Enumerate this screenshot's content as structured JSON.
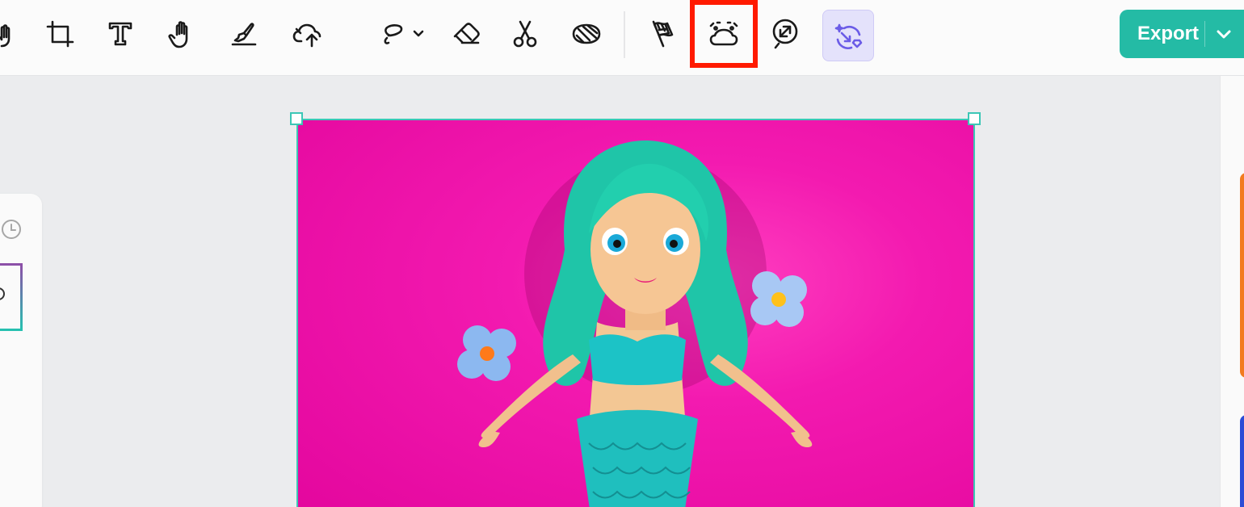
{
  "toolbar": {
    "tools": [
      {
        "name": "effects-tool",
        "icon": "partial-hand-icon"
      },
      {
        "name": "crop-tool",
        "icon": "crop-icon"
      },
      {
        "name": "text-tool",
        "icon": "text-icon"
      },
      {
        "name": "hand-tool",
        "icon": "hand-icon"
      },
      {
        "name": "brush-tool",
        "icon": "brush-icon"
      },
      {
        "name": "upload-tool",
        "icon": "cloud-upload-icon"
      },
      {
        "name": "lasso-tool",
        "icon": "lasso-icon"
      },
      {
        "name": "eraser-tool",
        "icon": "eraser-icon"
      },
      {
        "name": "cutout-tool",
        "icon": "scissors-icon"
      },
      {
        "name": "remove-bg-tool",
        "icon": "striped-shape-icon"
      },
      {
        "name": "flag-tool",
        "icon": "checkered-flag-icon"
      },
      {
        "name": "expand-tool",
        "icon": "cloud-expand-icon",
        "highlighted": true
      },
      {
        "name": "upscale-tool",
        "icon": "resize-circle-icon"
      },
      {
        "name": "ai-magic-tool",
        "icon": "sparkle-swap-icon",
        "active": true
      }
    ],
    "export_label": "Export"
  },
  "colors": {
    "accent": "#24bba5",
    "highlight": "#ff1a00",
    "active_tool": "#6b5ce7",
    "canvas_bg": "#f31ab0"
  }
}
